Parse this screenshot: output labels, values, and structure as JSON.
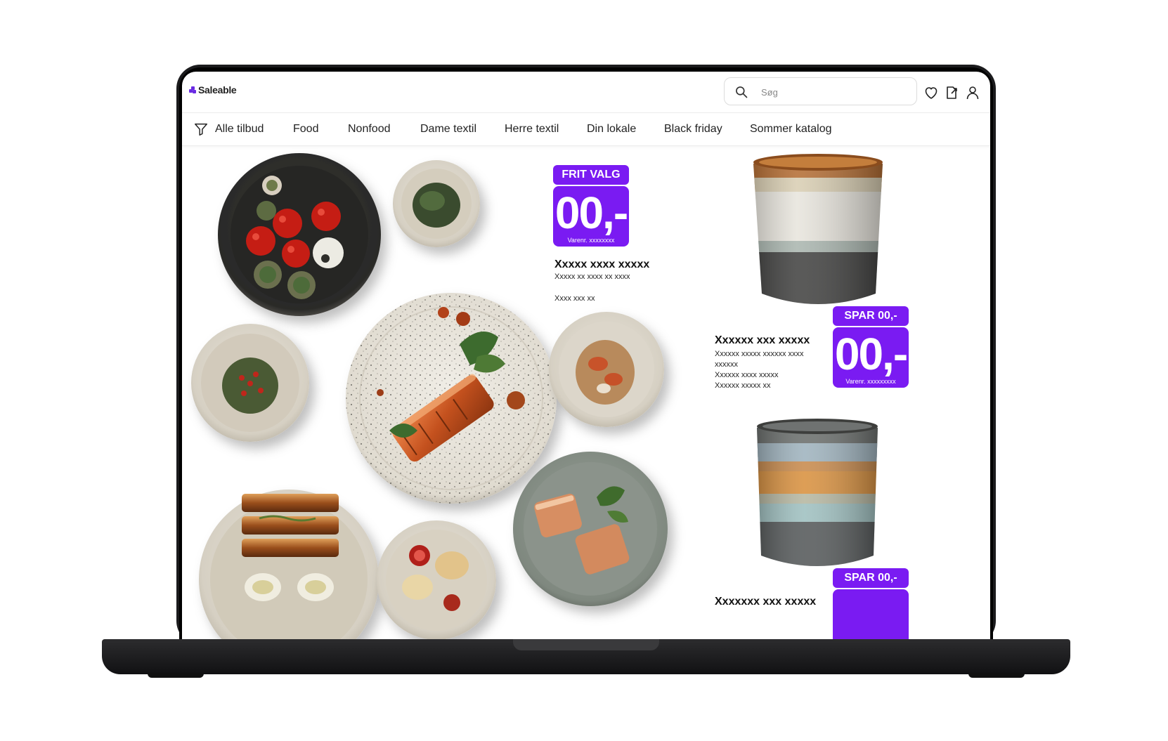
{
  "header": {
    "logo_text": "Saleable",
    "search_placeholder": "Søg"
  },
  "nav": {
    "items": [
      "Alle tilbud",
      "Food",
      "Nonfood",
      "Dame textil",
      "Herre textil",
      "Din lokale",
      "Black friday",
      "Sommer katalog"
    ]
  },
  "offers": [
    {
      "badge": "FRIT VALG",
      "price": "00,-",
      "varenr": "Varenr. xxxxxxxx",
      "title": "Xxxxx xxxx xxxxx",
      "lines": [
        "Xxxxx xx xxxx xx xxxx"
      ],
      "extra": "Xxxx xxx xx"
    },
    {
      "badge": "SPAR 00,-",
      "price": "00,-",
      "varenr": "Varenr. xxxxxxxxx",
      "title": "Xxxxxx xxx xxxxx",
      "lines": [
        "Xxxxxx xxxxx xxxxxx xxxx",
        "xxxxxx",
        "Xxxxxx xxxx xxxxx",
        "Xxxxxx xxxxx xx"
      ]
    },
    {
      "badge": "SPAR 00,-",
      "title": "Xxxxxxx xxx xxxxx"
    }
  ],
  "colors": {
    "accent": "#7a1bf2",
    "logo": "#6a2be3"
  }
}
